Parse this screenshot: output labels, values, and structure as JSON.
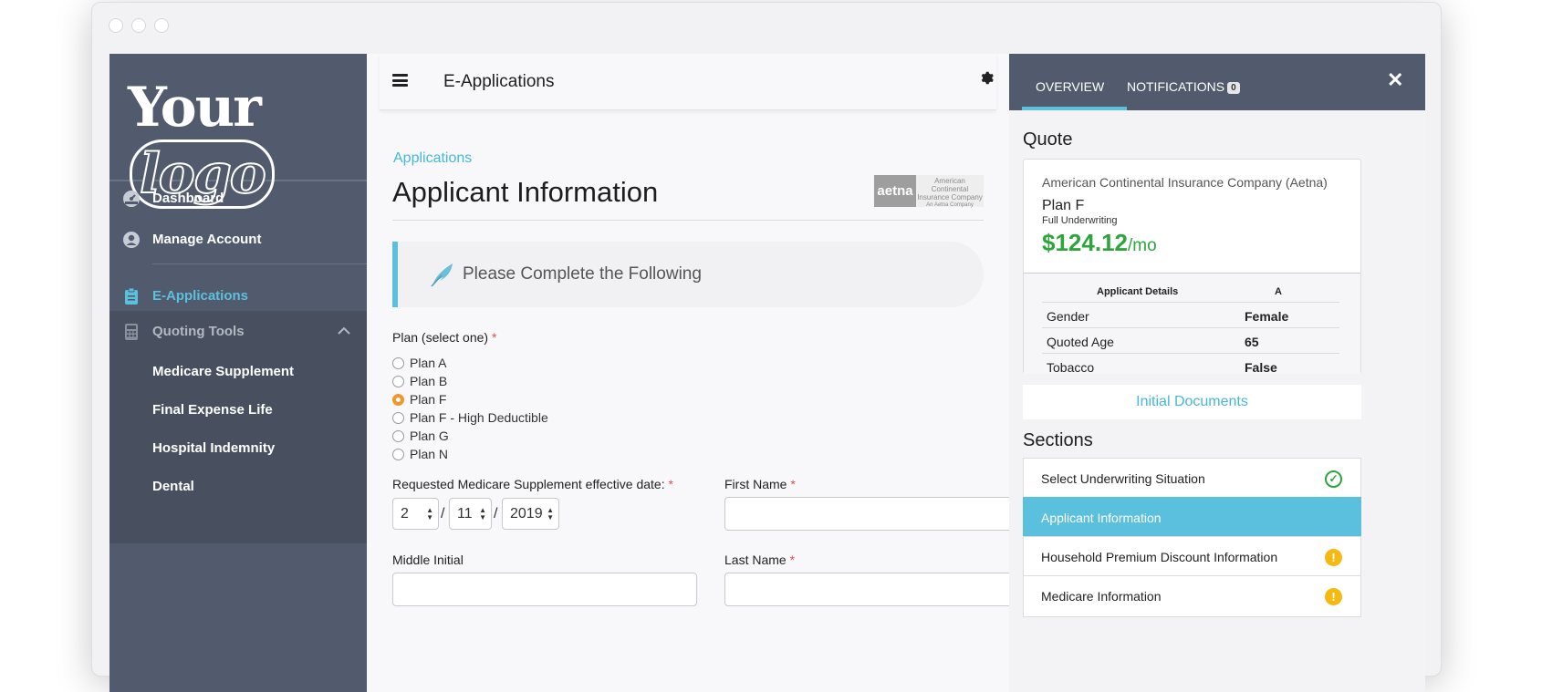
{
  "logo": {
    "part1": "Your",
    "part2": "logo"
  },
  "sidebar": {
    "dashboard": "Dashboard",
    "manage_account": "Manage Account",
    "e_applications": "E-Applications",
    "quoting_tools": "Quoting Tools",
    "sub_items": [
      "Medicare Supplement",
      "Final Expense Life",
      "Hospital Indemnity",
      "Dental"
    ]
  },
  "header": {
    "title": "E-Applications"
  },
  "main": {
    "breadcrumb": "Applications",
    "page_title": "Applicant Information",
    "aetna_logo": {
      "mark": "aetna",
      "line1": "American",
      "line2": "Continental",
      "line3": "Insurance Company",
      "line4": "An Aetna Company"
    },
    "callout": "Please Complete the Following",
    "plan_label": "Plan (select one)",
    "required": "*",
    "plans": [
      "Plan A",
      "Plan B",
      "Plan F",
      "Plan F - High Deductible",
      "Plan G",
      "Plan N"
    ],
    "selected_plan": "Plan F",
    "effective_date_label": "Requested Medicare Supplement effective date:",
    "date": {
      "month": "2",
      "day": "11",
      "year": "2019",
      "sep": "/"
    },
    "first_name_label": "First Name",
    "middle_initial_label": "Middle Initial",
    "last_name_label": "Last Name"
  },
  "panel": {
    "tabs": {
      "overview": "OVERVIEW",
      "notifications": "NOTIFICATIONS",
      "notifications_count": "0"
    },
    "quote_heading": "Quote",
    "quote": {
      "company": "American Continental Insurance Company (Aetna)",
      "plan": "Plan F",
      "underwriting": "Full Underwriting",
      "price": "$124.12",
      "per": "/mo",
      "details_header": "Applicant Details",
      "col_header": "A",
      "rows": [
        {
          "key": "Gender",
          "value": "Female"
        },
        {
          "key": "Quoted Age",
          "value": "65"
        },
        {
          "key": "Tobacco",
          "value": "False"
        }
      ]
    },
    "initial_documents": "Initial Documents",
    "sections_heading": "Sections",
    "sections": [
      {
        "title": "Select Underwriting Situation",
        "status": "complete"
      },
      {
        "title": "Applicant Information",
        "status": "active"
      },
      {
        "title": "Household Premium Discount Information",
        "status": "warning"
      },
      {
        "title": "Medicare Information",
        "status": "warning"
      }
    ]
  },
  "colors": {
    "accent": "#5bc0de",
    "sidebar": "#525b6d",
    "price": "#2ca63a",
    "radio_selected": "#f0962b",
    "warning": "#f5b914"
  }
}
